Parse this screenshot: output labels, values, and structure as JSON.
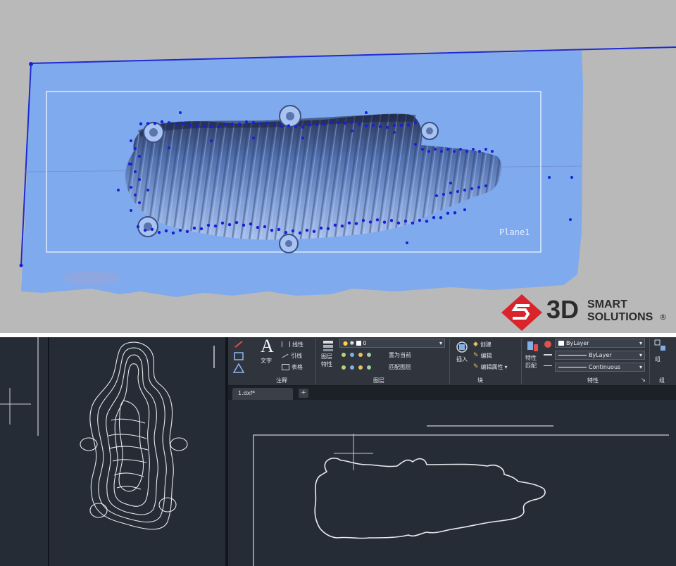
{
  "scan_view": {
    "plane_label": "Plane1"
  },
  "logo": {
    "big": "3D",
    "line1": "SMART",
    "line2": "SOLUTIONS",
    "registered": "®",
    "brand_color": "#d8242a"
  },
  "ribbon": {
    "text_tool": {
      "icon_letter": "A",
      "label": "文字"
    },
    "dim_items": [
      "线性",
      "引线",
      "表格"
    ],
    "annotation_panel": "注释",
    "layer_combo_value": "0",
    "layer_buttons": [
      "置为当前",
      "匹配图层"
    ],
    "layer_prop_label": "图层\n特性",
    "layers_panel": "图层",
    "insert_label": "插入",
    "block_items": [
      "创建",
      "编辑",
      "编辑属性"
    ],
    "block_panel": "块",
    "match_label": "特性\n匹配",
    "prop_combos": [
      "ByLayer",
      "ByLayer",
      "Continuous"
    ],
    "properties_panel": "特性",
    "group_label": "组",
    "group_panel": "组"
  },
  "file_tab": {
    "name": "1.dxf*"
  },
  "colors": {
    "scan_blue": "#7fa9ec",
    "point_blue": "#1b1fd6",
    "cad_bg": "#222831",
    "ribbon_bg": "#2f343d"
  }
}
